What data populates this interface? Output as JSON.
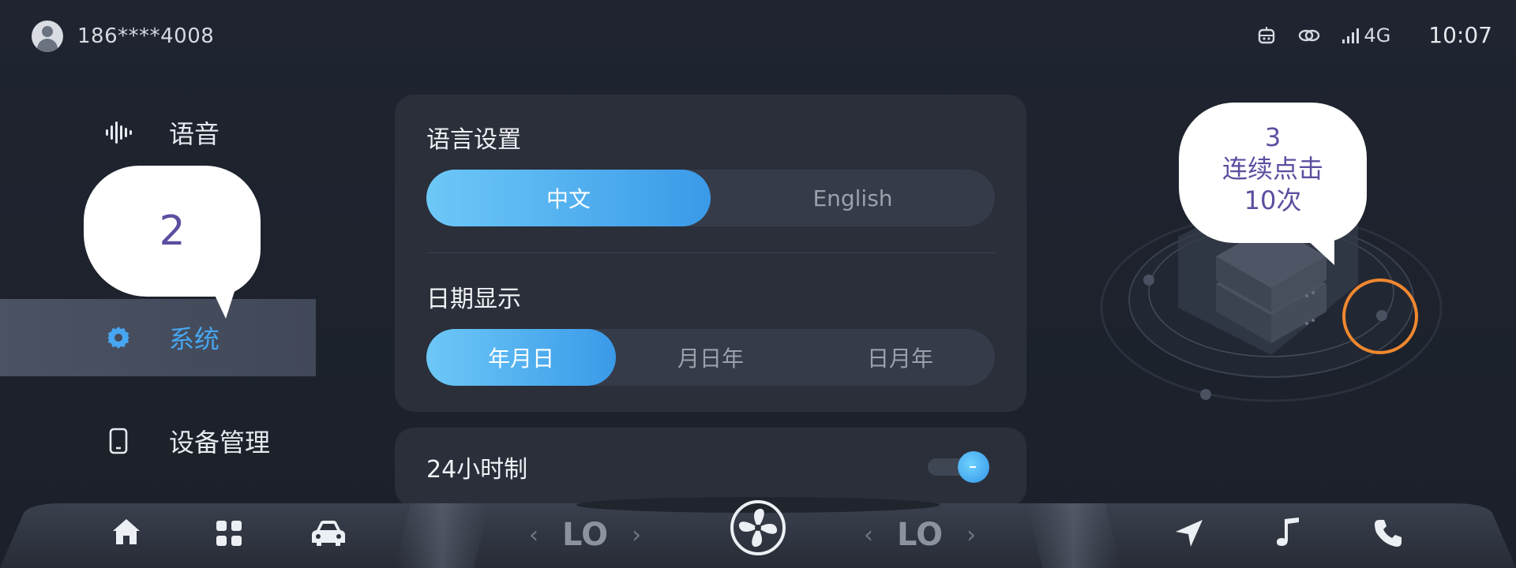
{
  "status_bar": {
    "phone": "186****4008",
    "network": "4G",
    "time": "10:07"
  },
  "sidebar": {
    "items": [
      {
        "label": "语音",
        "icon": "voice-wave-icon",
        "active": false
      },
      {
        "label": "系统",
        "icon": "gear-icon",
        "active": true
      },
      {
        "label": "设备管理",
        "icon": "phone-device-icon",
        "active": false
      }
    ]
  },
  "bubbles": {
    "left": "2",
    "right_lines": [
      "3",
      "连续点击",
      "10次"
    ]
  },
  "language_settings": {
    "title": "语言设置",
    "options": [
      "中文",
      "English"
    ],
    "selected": "中文"
  },
  "date_display": {
    "title": "日期显示",
    "options": [
      "年月日",
      "月日年",
      "日月年"
    ],
    "selected": "年月日"
  },
  "time_format": {
    "title": "24小时制",
    "enabled": true
  },
  "dock": {
    "left_temp": "LO",
    "right_temp": "LO",
    "left_buttons": [
      "home-icon",
      "apps-grid-icon",
      "car-icon"
    ],
    "right_buttons": [
      "navigation-icon",
      "music-icon",
      "phone-call-icon"
    ]
  },
  "colors": {
    "accent": "#47a6f0",
    "highlight_ring": "#f0882f",
    "bubble_text": "#5b4fa0"
  }
}
